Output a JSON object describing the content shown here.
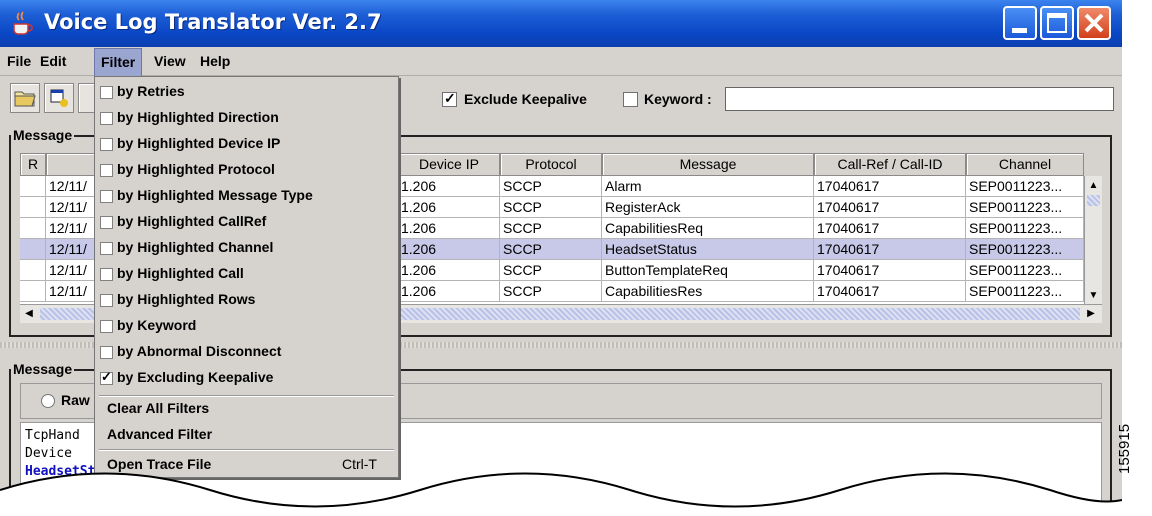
{
  "window": {
    "title": "Voice Log Translator Ver. 2.7",
    "colors": {
      "titlebar": "#0a47c6",
      "selected_row": "#c8c8e8",
      "menu_highlight": "#9aa5d0",
      "decoded_text": "#1010c0"
    }
  },
  "menubar": {
    "file": "File",
    "edit": "Edit",
    "filter": "Filter",
    "view": "View",
    "help": "Help"
  },
  "toolbar": {
    "exclude_keepalive": {
      "label": "Exclude Keepalive",
      "checked": true
    },
    "keyword": {
      "label": "Keyword :",
      "checked": false,
      "value": ""
    }
  },
  "messages_panel": {
    "title": "Message",
    "columns": [
      "R",
      "",
      "Device IP",
      "Protocol",
      "Message",
      "Call-Ref / Call-ID",
      "Channel"
    ],
    "rows": [
      {
        "date": "12/11/",
        "ip": "1.206",
        "protocol": "SCCP",
        "message": "Alarm",
        "callref": "17040617",
        "channel": "SEP0011223..."
      },
      {
        "date": "12/11/",
        "ip": "1.206",
        "protocol": "SCCP",
        "message": "RegisterAck",
        "callref": "17040617",
        "channel": "SEP0011223..."
      },
      {
        "date": "12/11/",
        "ip": "1.206",
        "protocol": "SCCP",
        "message": "CapabilitiesReq",
        "callref": "17040617",
        "channel": "SEP0011223..."
      },
      {
        "date": "12/11/",
        "ip": "1.206",
        "protocol": "SCCP",
        "message": "HeadsetStatus",
        "callref": "17040617",
        "channel": "SEP0011223..."
      },
      {
        "date": "12/11/",
        "ip": "1.206",
        "protocol": "SCCP",
        "message": "ButtonTemplateReq",
        "callref": "17040617",
        "channel": "SEP0011223..."
      },
      {
        "date": "12/11/",
        "ip": "1.206",
        "protocol": "SCCP",
        "message": "CapabilitiesRes",
        "callref": "17040617",
        "channel": "SEP0011223..."
      }
    ]
  },
  "detail_panel": {
    "title": "Message",
    "raw_label": "Raw",
    "lines": [
      "TcpHand",
      "Device",
      "HeadsetStatus"
    ]
  },
  "filter_menu": {
    "items": [
      {
        "label": "by Retries",
        "checked": false
      },
      {
        "label": "by Highlighted Direction",
        "checked": false
      },
      {
        "label": "by Highlighted Device IP",
        "checked": false
      },
      {
        "label": "by Highlighted Protocol",
        "checked": false
      },
      {
        "label": "by Highlighted Message Type",
        "checked": false
      },
      {
        "label": "by Highlighted CallRef",
        "checked": false
      },
      {
        "label": "by Highlighted Channel",
        "checked": false
      },
      {
        "label": "by Highlighted Call",
        "checked": false
      },
      {
        "label": "by Highlighted Rows",
        "checked": false
      },
      {
        "label": "by Keyword",
        "checked": false
      },
      {
        "label": "by Abnormal Disconnect",
        "checked": false
      },
      {
        "label": "by Excluding Keepalive",
        "checked": true
      }
    ],
    "clear_all": "Clear All Filters",
    "advanced": "Advanced Filter",
    "open_trace": "Open Trace File",
    "open_trace_shortcut": "Ctrl-T"
  },
  "figure_id": "155915"
}
